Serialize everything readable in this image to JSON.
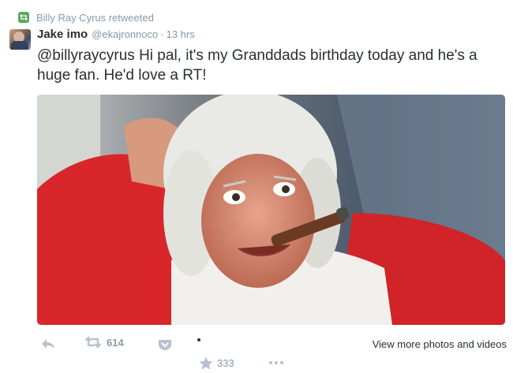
{
  "retweet_context": {
    "text": "Billy Ray Cyrus retweeted",
    "icon": "retweet-icon"
  },
  "author": {
    "name": "Jake imo",
    "handle": "@ekajronnoco",
    "separator": "·",
    "time": "13 hrs"
  },
  "tweet": {
    "text": "@billyraycyrus Hi pal, it's my Granddads birthday today and he's a huge fan. He'd love a RT!"
  },
  "actions": {
    "reply_icon": "reply-icon",
    "retweet_icon": "retweet-icon",
    "retweet_count": "614",
    "pocket_icon": "pocket-icon",
    "favorite_icon": "star-icon",
    "favorite_count": "333",
    "more_icon": "more-icon",
    "view_more": "View more photos and videos"
  },
  "colors": {
    "retweet_green": "#5ba85e",
    "muted": "#8899a6",
    "text": "#292f33",
    "icon_gray": "#b8c2cc"
  }
}
